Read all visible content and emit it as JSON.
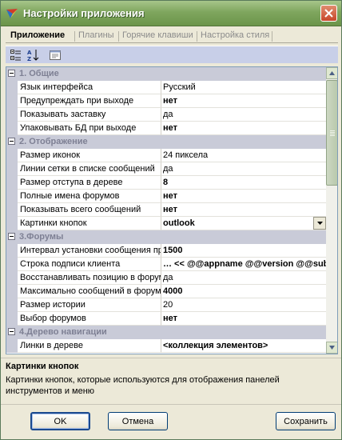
{
  "window": {
    "title": "Настройки приложения"
  },
  "tabs": [
    "Приложение",
    "Плагины",
    "Горячие клавиши",
    "Настройка стиля"
  ],
  "grid": {
    "rows": [
      {
        "kind": "cat",
        "label": "1. Общие"
      },
      {
        "kind": "prop",
        "name": "Язык интерфейса",
        "value": "Русский",
        "bold": false
      },
      {
        "kind": "prop",
        "name": "Предупреждать при выходе",
        "value": "нет",
        "bold": true
      },
      {
        "kind": "prop",
        "name": "Показывать заставку",
        "value": "да",
        "bold": false
      },
      {
        "kind": "prop",
        "name": "Упаковывать БД при выходе",
        "value": "нет",
        "bold": true
      },
      {
        "kind": "cat",
        "label": "2. Отображение"
      },
      {
        "kind": "prop",
        "name": "Размер иконок",
        "value": "24 пиксела",
        "bold": false
      },
      {
        "kind": "prop",
        "name": "Линии сетки в списке сообщений",
        "value": "да",
        "bold": false
      },
      {
        "kind": "prop",
        "name": "Размер отступа в дереве",
        "value": "8",
        "bold": true
      },
      {
        "kind": "prop",
        "name": "Полные имена форумов",
        "value": "нет",
        "bold": true
      },
      {
        "kind": "prop",
        "name": "Показывать всего сообщений",
        "value": "нет",
        "bold": true
      },
      {
        "kind": "prop",
        "name": "Картинки кнопок",
        "value": "outlook",
        "bold": true,
        "selected": true,
        "dropdown": true
      },
      {
        "kind": "cat",
        "label": "3.Форумы"
      },
      {
        "kind": "prop",
        "name": "Интервал установки сообщения прочитанным",
        "value": "1500",
        "bold": true
      },
      {
        "kind": "prop",
        "name": "Строка подписи клиента",
        "value": "… << @@appname @@version @@subject",
        "bold": true
      },
      {
        "kind": "prop",
        "name": "Восстанавливать позицию в форуме",
        "value": "да",
        "bold": false
      },
      {
        "kind": "prop",
        "name": "Максимально сообщений в форуме",
        "value": "4000",
        "bold": true
      },
      {
        "kind": "prop",
        "name": "Размер истории",
        "value": "20",
        "bold": false
      },
      {
        "kind": "prop",
        "name": "Выбор форумов",
        "value": "нет",
        "bold": true
      },
      {
        "kind": "cat",
        "label": "4.Дерево навигации"
      },
      {
        "kind": "prop",
        "name": "Линки в дереве",
        "value": "<коллекция элементов>",
        "bold": true
      }
    ]
  },
  "description": {
    "title": "Картинки кнопок",
    "text": "Картинки кнопок, которые используются для отображения панелей инструментов и меню"
  },
  "buttons": {
    "ok": "OK",
    "cancel": "Отмена",
    "save": "Сохранить"
  },
  "colors": {
    "title_bar": "#7fa65e",
    "category_bg": "#c9cbd8",
    "toolbar_bg": "#c8cfe8",
    "category_text": "#7e8094"
  }
}
